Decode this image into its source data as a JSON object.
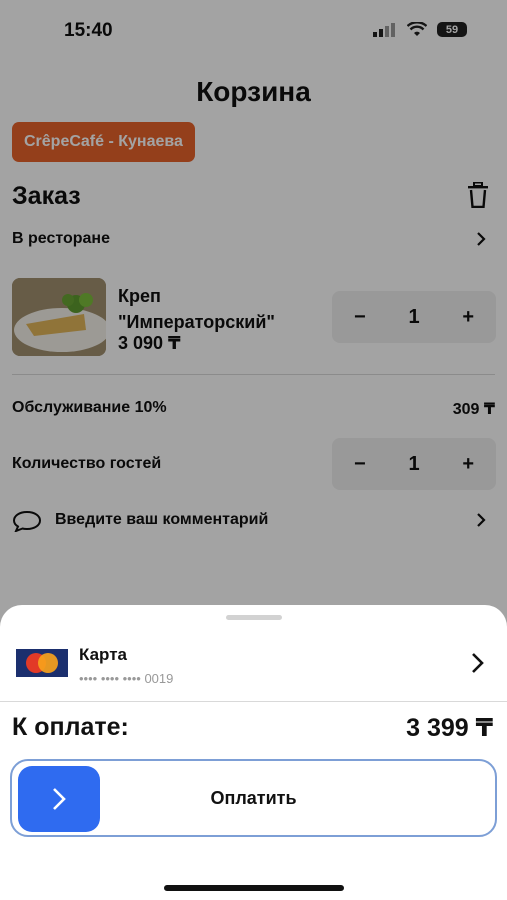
{
  "status_bar": {
    "time": "15:40",
    "battery": "59"
  },
  "header": {
    "title": "Корзина"
  },
  "restaurant": {
    "name": "CrêpeCafé - Кунаева"
  },
  "order": {
    "title": "Заказ",
    "mode": "В ресторане",
    "item": {
      "name_line1": "Креп",
      "name_line2": "\"Императорский\"",
      "price": "3 090 ₸",
      "qty": "1"
    },
    "service": {
      "label": "Обслуживание 10%",
      "value": "309 ₸"
    },
    "guests": {
      "label": "Количество гостей",
      "qty": "1"
    },
    "comment_placeholder": "Введите ваш комментарий"
  },
  "stepper": {
    "minus": "−",
    "plus": "+"
  },
  "payment": {
    "method_label": "Карта",
    "card_mask": "•••• •••• •••• 0019",
    "card_brand": "MasterCard",
    "total_label": "К оплате:",
    "total_value": "3 399 ₸",
    "pay_button": "Оплатить"
  },
  "colors": {
    "accent": "#e8632b",
    "primary": "#2f6bf0",
    "button_border": "#7d9fd6"
  }
}
